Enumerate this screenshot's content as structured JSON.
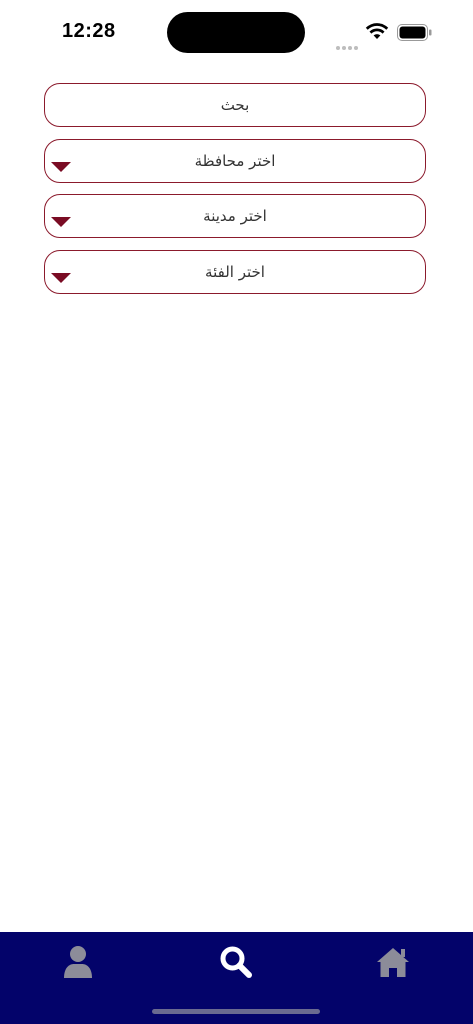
{
  "status_bar": {
    "time": "12:28",
    "signal_icon": "cellular-dots-icon",
    "wifi_icon": "wifi-icon",
    "battery_icon": "battery-icon"
  },
  "form": {
    "search_label": "بحث",
    "governorate_label": "اختر محافظة",
    "city_label": "اختر مدينة",
    "category_label": "اختر الفئة"
  },
  "tab_bar": {
    "items": [
      {
        "icon": "user-icon",
        "active": false
      },
      {
        "icon": "search-icon",
        "active": true
      },
      {
        "icon": "home-icon",
        "active": false
      }
    ]
  },
  "colors": {
    "accent": "#8b1a2c",
    "arrow": "#7a0c24",
    "tab_bar_bg": "#03036a",
    "tab_active": "#ffffff",
    "tab_inactive": "#8c8c99"
  }
}
